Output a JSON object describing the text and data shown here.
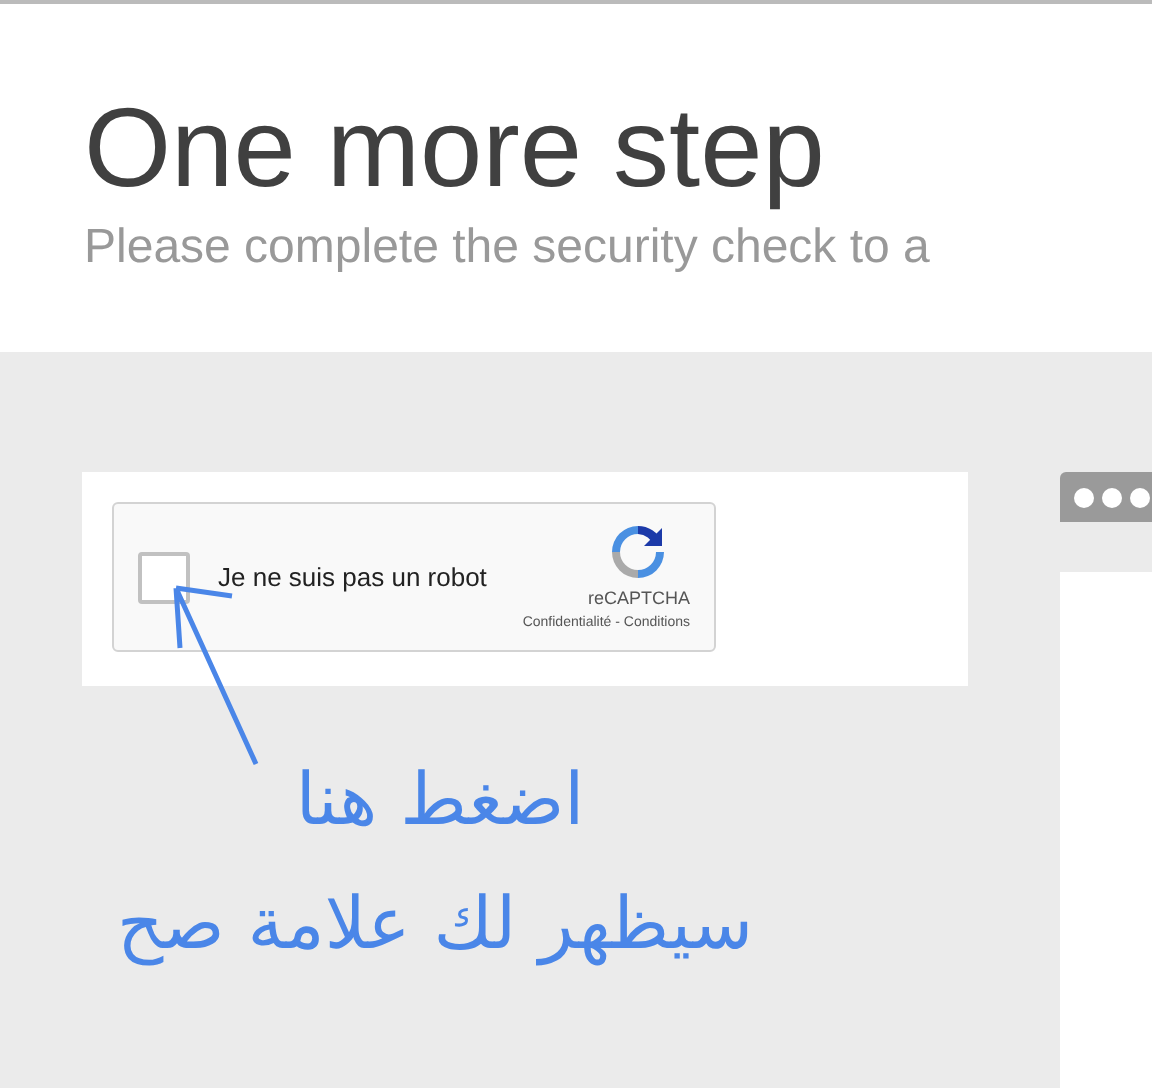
{
  "header": {
    "title": "One more step",
    "subtitle": "Please complete the security check to a"
  },
  "captcha": {
    "checked": false,
    "label": "Je ne suis pas un robot",
    "brand": "reCAPTCHA",
    "links": "Confidentialité - Conditions"
  },
  "annotation": {
    "lines": [
      "اضغط هنا",
      "سيظهر لك علامة صح"
    ]
  }
}
